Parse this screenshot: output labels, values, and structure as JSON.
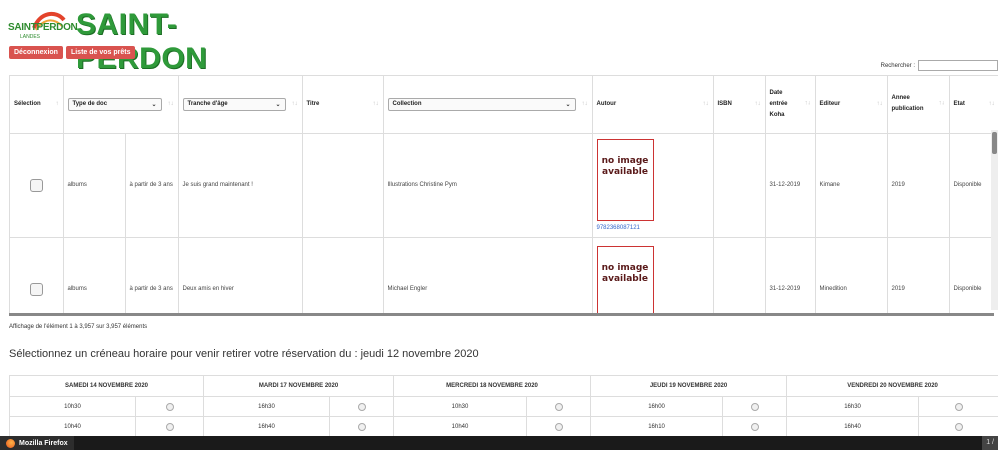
{
  "header": {
    "logo_small": "SAINTPERDON",
    "logo_small_sub": "LANDES",
    "title": "SAINT-PERDON"
  },
  "buttons": {
    "logout": "Déconnexion",
    "loans": "Liste de vos prêts"
  },
  "search": {
    "label": "Rechercher :",
    "value": ""
  },
  "table": {
    "headers": {
      "selection": "Sélection",
      "type_doc": "Type de doc",
      "age": "Tranche d'âge",
      "titre": "Titre",
      "collection": "Collection",
      "auteur": "Autour",
      "isbn": "ISBN",
      "date": "Date\nentrée\nKoha",
      "editeur": "Editeur",
      "annee": "Annee\npublication",
      "etat": "Etat"
    },
    "sort_glyph": "↑↓",
    "sort_glyph_first": "↑",
    "rows": [
      {
        "type": "albums",
        "age": "à partir de 3 ans",
        "titre": "Je suis grand maintenant !",
        "collection": "",
        "auteur": "Illustrations Christine Pym",
        "image_text": "no image available",
        "isbn_link": "9782368087121",
        "isbn": "",
        "date": "31-12-2019",
        "editeur": "Kimane",
        "annee": "2019",
        "etat": "Disponible"
      },
      {
        "type": "albums",
        "age": "à partir de 3 ans",
        "titre": "Deux amis en hiver",
        "collection": "",
        "auteur": "Michael Engler",
        "image_text": "no image available",
        "isbn_link": "",
        "isbn": "",
        "date": "31-12-2019",
        "editeur": "Minedition",
        "annee": "2019",
        "etat": "Disponible"
      }
    ]
  },
  "info": "Affichage de l'élément 1 à 3,957 sur 3,957 éléments",
  "slots": {
    "title": "Sélectionnez un créneau horaire pour venir retirer votre réservation du : jeudi 12 novembre 2020",
    "days": [
      {
        "label": "SAMEDI 14 NOVEMBRE 2020",
        "times": [
          "10h30",
          "10h40"
        ]
      },
      {
        "label": "MARDI 17 NOVEMBRE 2020",
        "times": [
          "16h30",
          "16h40"
        ]
      },
      {
        "label": "MERCREDI 18 NOVEMBRE 2020",
        "times": [
          "10h30",
          "10h40"
        ]
      },
      {
        "label": "JEUDI 19 NOVEMBRE 2020",
        "times": [
          "16h00",
          "16h10"
        ]
      },
      {
        "label": "VENDREDI 20 NOVEMBRE 2020",
        "times": [
          "16h30",
          "16h40"
        ]
      }
    ]
  },
  "taskbar": {
    "app": "Mozilla Firefox",
    "right": "1 /"
  },
  "colors": {
    "brand": "#2f9a3a",
    "button": "#d9534f",
    "link": "#3366cc"
  }
}
